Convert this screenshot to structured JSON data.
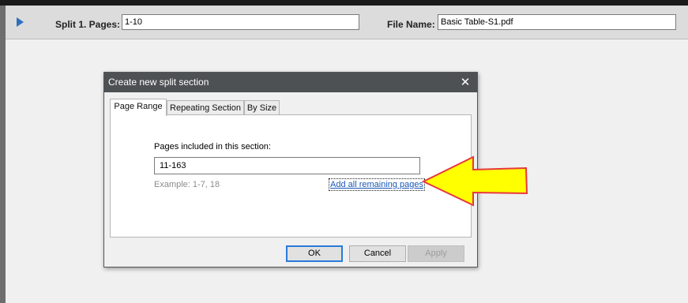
{
  "split_row": {
    "label": "Split 1. Pages:",
    "pages_value": "1-10",
    "file_name_label": "File Name:",
    "file_name_value": "Basic Table-S1.pdf"
  },
  "dialog": {
    "title": "Create new split section",
    "close_glyph": "✕",
    "tabs": [
      {
        "label": "Page Range",
        "active": true
      },
      {
        "label": "Repeating Section",
        "active": false
      },
      {
        "label": "By Size",
        "active": false
      }
    ],
    "pages_label": "Pages included in this section:",
    "pages_value": "11-163",
    "example_text": "Example: 1-7, 18",
    "add_all_link": "Add all remaining pages",
    "buttons": {
      "ok": "OK",
      "cancel": "Cancel",
      "apply": "Apply"
    }
  },
  "colors": {
    "title_bar": "#4e5154",
    "callout_fill": "#ffff00",
    "callout_stroke": "#e8383d",
    "link": "#1a57b8",
    "expand_arrow": "#2f6fbf"
  },
  "icons": {
    "expand": "triangle-right",
    "close": "x",
    "callout": "arrow-left"
  }
}
